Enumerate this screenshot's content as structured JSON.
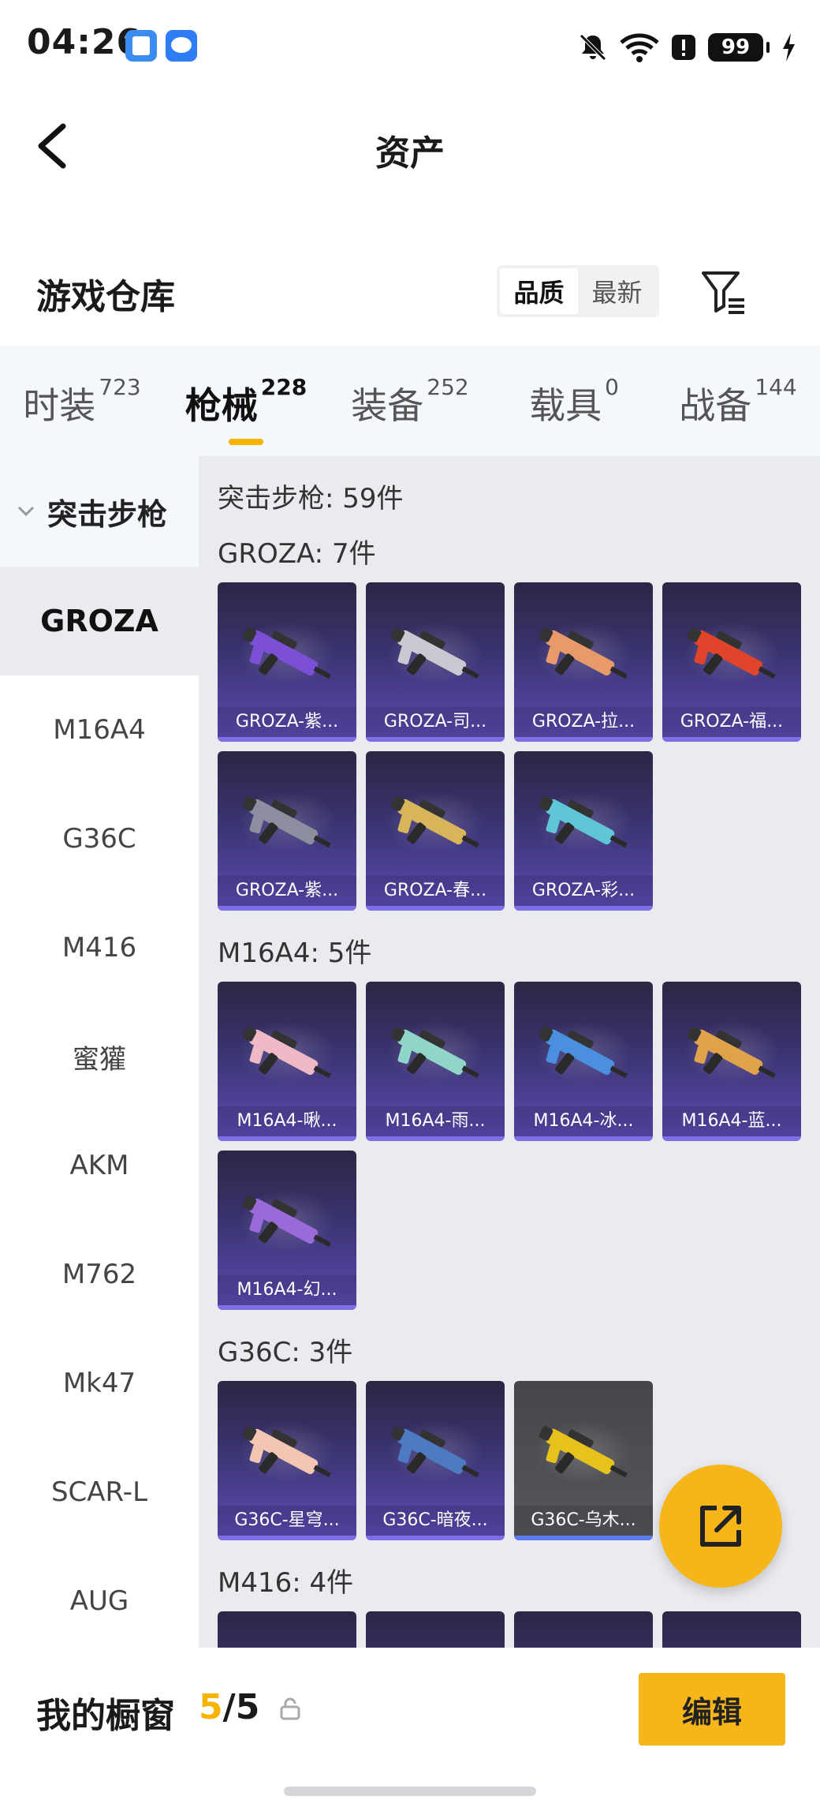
{
  "status_bar": {
    "time": "04:26",
    "battery": "99"
  },
  "header": {
    "title": "资产"
  },
  "warehouse": {
    "title": "游戏仓库",
    "sort_options": [
      "品质",
      "最新"
    ],
    "sort_active": "品质"
  },
  "category_tabs": [
    {
      "label": "时装",
      "count": "723"
    },
    {
      "label": "枪械",
      "count": "228",
      "active": true
    },
    {
      "label": "装备",
      "count": "252"
    },
    {
      "label": "载具",
      "count": "0"
    },
    {
      "label": "战备",
      "count": "144"
    }
  ],
  "sidenav": {
    "group": "突击步枪",
    "items": [
      "GROZA",
      "M16A4",
      "G36C",
      "M416",
      "蜜獾",
      "AKM",
      "M762",
      "Mk47",
      "SCAR-L",
      "AUG"
    ],
    "active": "GROZA"
  },
  "main": {
    "total": "突击步枪: 59件",
    "groups": [
      {
        "title": "GROZA: 7件",
        "items": [
          {
            "name": "GROZA-紫...",
            "color": "#7b4fd6"
          },
          {
            "name": "GROZA-司...",
            "color": "#c9c9d2"
          },
          {
            "name": "GROZA-拉...",
            "color": "#e89a6a"
          },
          {
            "name": "GROZA-福...",
            "color": "#e0442b"
          },
          {
            "name": "GROZA-紫...",
            "color": "#8c8fa0"
          },
          {
            "name": "GROZA-春...",
            "color": "#d8b45a"
          },
          {
            "name": "GROZA-彩...",
            "color": "#5fc6d8"
          }
        ]
      },
      {
        "title": "M16A4: 5件",
        "items": [
          {
            "name": "M16A4-啾...",
            "color": "#f1b9c6"
          },
          {
            "name": "M16A4-雨...",
            "color": "#8fd6c8"
          },
          {
            "name": "M16A4-冰...",
            "color": "#4a8fe0"
          },
          {
            "name": "M16A4-蓝...",
            "color": "#e0a24a"
          },
          {
            "name": "M16A4-幻...",
            "color": "#9a6ad8"
          }
        ]
      },
      {
        "title": "G36C: 3件",
        "items": [
          {
            "name": "G36C-星穹...",
            "color": "#f3c6b4"
          },
          {
            "name": "G36C-暗夜...",
            "color": "#4d7bc2"
          },
          {
            "name": "G36C-乌木...",
            "color": "#e8c21c",
            "grey": true
          }
        ]
      },
      {
        "title": "M416: 4件",
        "items": [
          {
            "name": "",
            "color": "#888"
          },
          {
            "name": "",
            "color": "#888"
          },
          {
            "name": "",
            "color": "#888"
          },
          {
            "name": "",
            "color": "#888"
          }
        ]
      }
    ]
  },
  "bottom_bar": {
    "label": "我的橱窗",
    "count_current": "5",
    "count_total": "/5",
    "edit_label": "编辑"
  },
  "accent_color": "#f6b61a"
}
